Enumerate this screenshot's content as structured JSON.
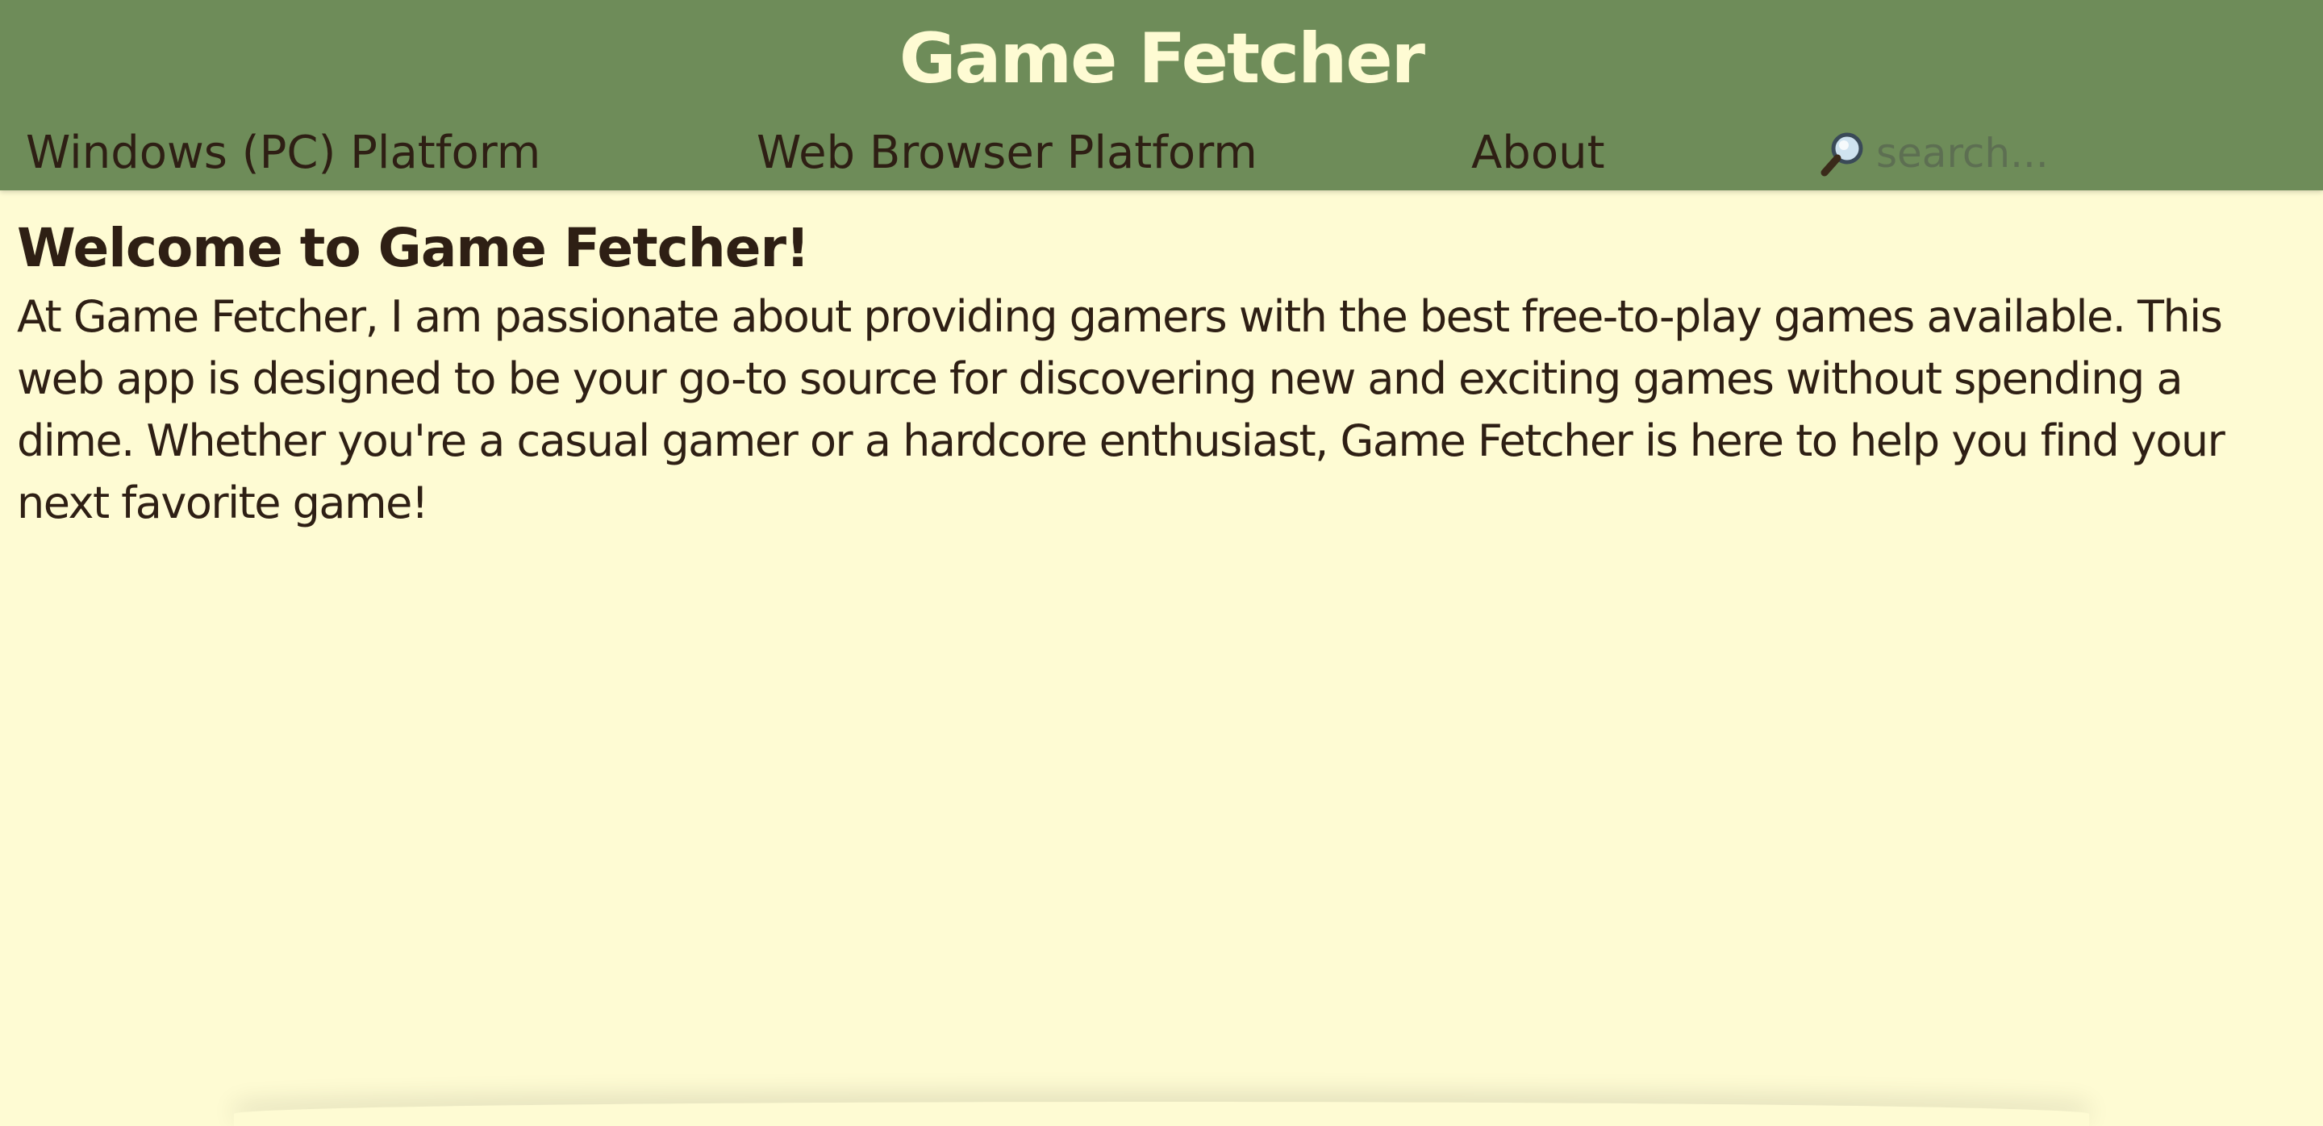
{
  "header": {
    "title": "Game Fetcher",
    "background_color": "#6e8c59",
    "title_color": "#fefbd3"
  },
  "nav": {
    "items": [
      {
        "label": "Windows (PC) Platform"
      },
      {
        "label": "Web Browser Platform"
      },
      {
        "label": "About"
      }
    ],
    "search": {
      "icon": "magnifying-glass-icon",
      "placeholder": "search..."
    }
  },
  "main": {
    "heading": "Welcome to Game Fetcher!",
    "paragraph": "At Game Fetcher, I am passionate about providing gamers with the best free-to-play games available. This web app is designed to be your go-to source for discovering new and exciting games without spending a dime. Whether you're a casual gamer or a hardcore enthusiast, Game Fetcher is here to help you find your next favorite game!"
  },
  "theme": {
    "page_background": "#fefbd3",
    "text_color": "#2e1f14"
  }
}
